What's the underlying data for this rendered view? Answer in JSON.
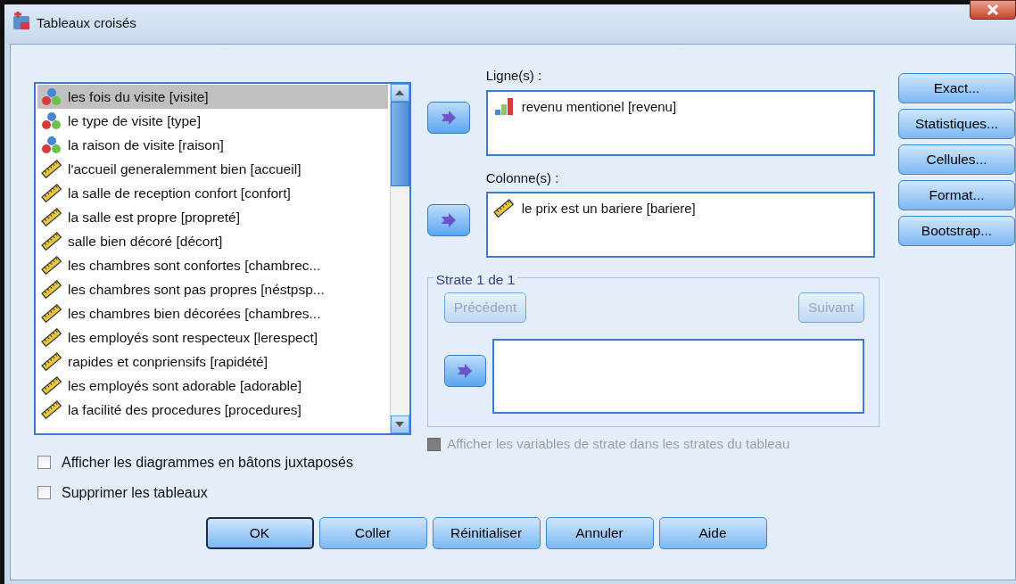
{
  "window": {
    "title": "Tableaux croisés"
  },
  "variables": [
    {
      "label": "les fois du visite [visite]",
      "kind": "nominal",
      "selected": true
    },
    {
      "label": "le type de visite [type]",
      "kind": "nominal",
      "selected": false
    },
    {
      "label": "la raison de visite [raison]",
      "kind": "nominal",
      "selected": false
    },
    {
      "label": "l'accueil generalemment bien [accueil]",
      "kind": "scale",
      "selected": false
    },
    {
      "label": "la salle de reception confort [confort]",
      "kind": "scale",
      "selected": false
    },
    {
      "label": "la salle est propre [propreté]",
      "kind": "scale",
      "selected": false
    },
    {
      "label": "salle bien décoré [décort]",
      "kind": "scale",
      "selected": false
    },
    {
      "label": "les chambres sont confortes [chambrec...",
      "kind": "scale",
      "selected": false
    },
    {
      "label": "les chambres sont pas propres [néstpsp...",
      "kind": "scale",
      "selected": false
    },
    {
      "label": "les chambres bien décorées [chambres...",
      "kind": "scale",
      "selected": false
    },
    {
      "label": "les employés sont respecteux [lerespect]",
      "kind": "scale",
      "selected": false
    },
    {
      "label": "rapides et conpriensifs [rapidété]",
      "kind": "scale",
      "selected": false
    },
    {
      "label": "les employés sont adorable [adorable]",
      "kind": "scale",
      "selected": false
    },
    {
      "label": "la facilité des procedures [procedures]",
      "kind": "scale",
      "selected": false
    }
  ],
  "rows_box": {
    "label": "Ligne(s) :",
    "items": [
      {
        "label": "revenu mentionel [revenu]",
        "kind": "ordinal"
      }
    ]
  },
  "columns_box": {
    "label": "Colonne(s) :",
    "items": [
      {
        "label": "le prix est un bariere [bariere]",
        "kind": "scale"
      }
    ]
  },
  "layer": {
    "title": "Strate 1 de 1",
    "previous": {
      "label": "Précédent",
      "disabled": true
    },
    "next": {
      "label": "Suivant",
      "disabled": true
    },
    "show_layer_vars": {
      "label": "Afficher les variables de strate dans les strates du tableau",
      "checked": false,
      "disabled": true
    }
  },
  "side_buttons": [
    "Exact...",
    "Statistiques...",
    "Cellules...",
    "Format...",
    "Bootstrap..."
  ],
  "options": [
    {
      "label": "Afficher les diagrammes en bâtons juxtaposés",
      "checked": false
    },
    {
      "label": "Supprimer les tableaux",
      "checked": false
    }
  ],
  "buttons": [
    {
      "label": "OK",
      "default": true
    },
    {
      "label": "Coller",
      "default": false
    },
    {
      "label": "Réinitialiser",
      "default": false
    },
    {
      "label": "Annuler",
      "default": false
    },
    {
      "label": "Aide",
      "default": false
    }
  ]
}
